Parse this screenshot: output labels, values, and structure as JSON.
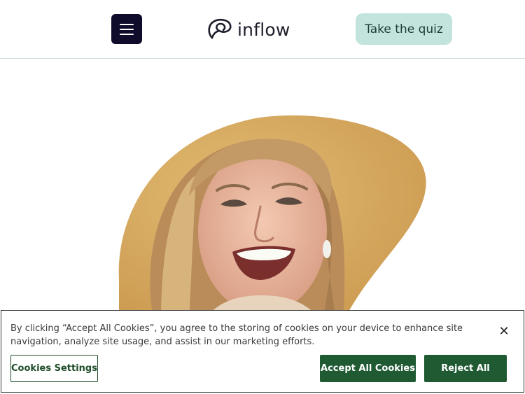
{
  "header": {
    "menu_icon": "hamburger-menu-icon",
    "logo_text": "inflow",
    "logo_icon": "inflow-loop-logo-icon",
    "quiz_button": "Take the quiz"
  },
  "hero": {
    "image": "smiling-woman-portrait"
  },
  "cookie_banner": {
    "text": "By clicking “Accept All Cookies”, you agree to the storing of cookies on your device to enhance site navigation, analyze site usage, and assist in our marketing efforts.",
    "settings_button": "Cookies Settings",
    "accept_button": "Accept All Cookies",
    "reject_button": "Reject All",
    "close_icon": "close-icon"
  },
  "colors": {
    "menu_bg": "#0e0b2b",
    "quiz_bg": "#c3e4dc",
    "cookie_button": "#1f5a33",
    "photo_bg": "#cf9f57"
  }
}
